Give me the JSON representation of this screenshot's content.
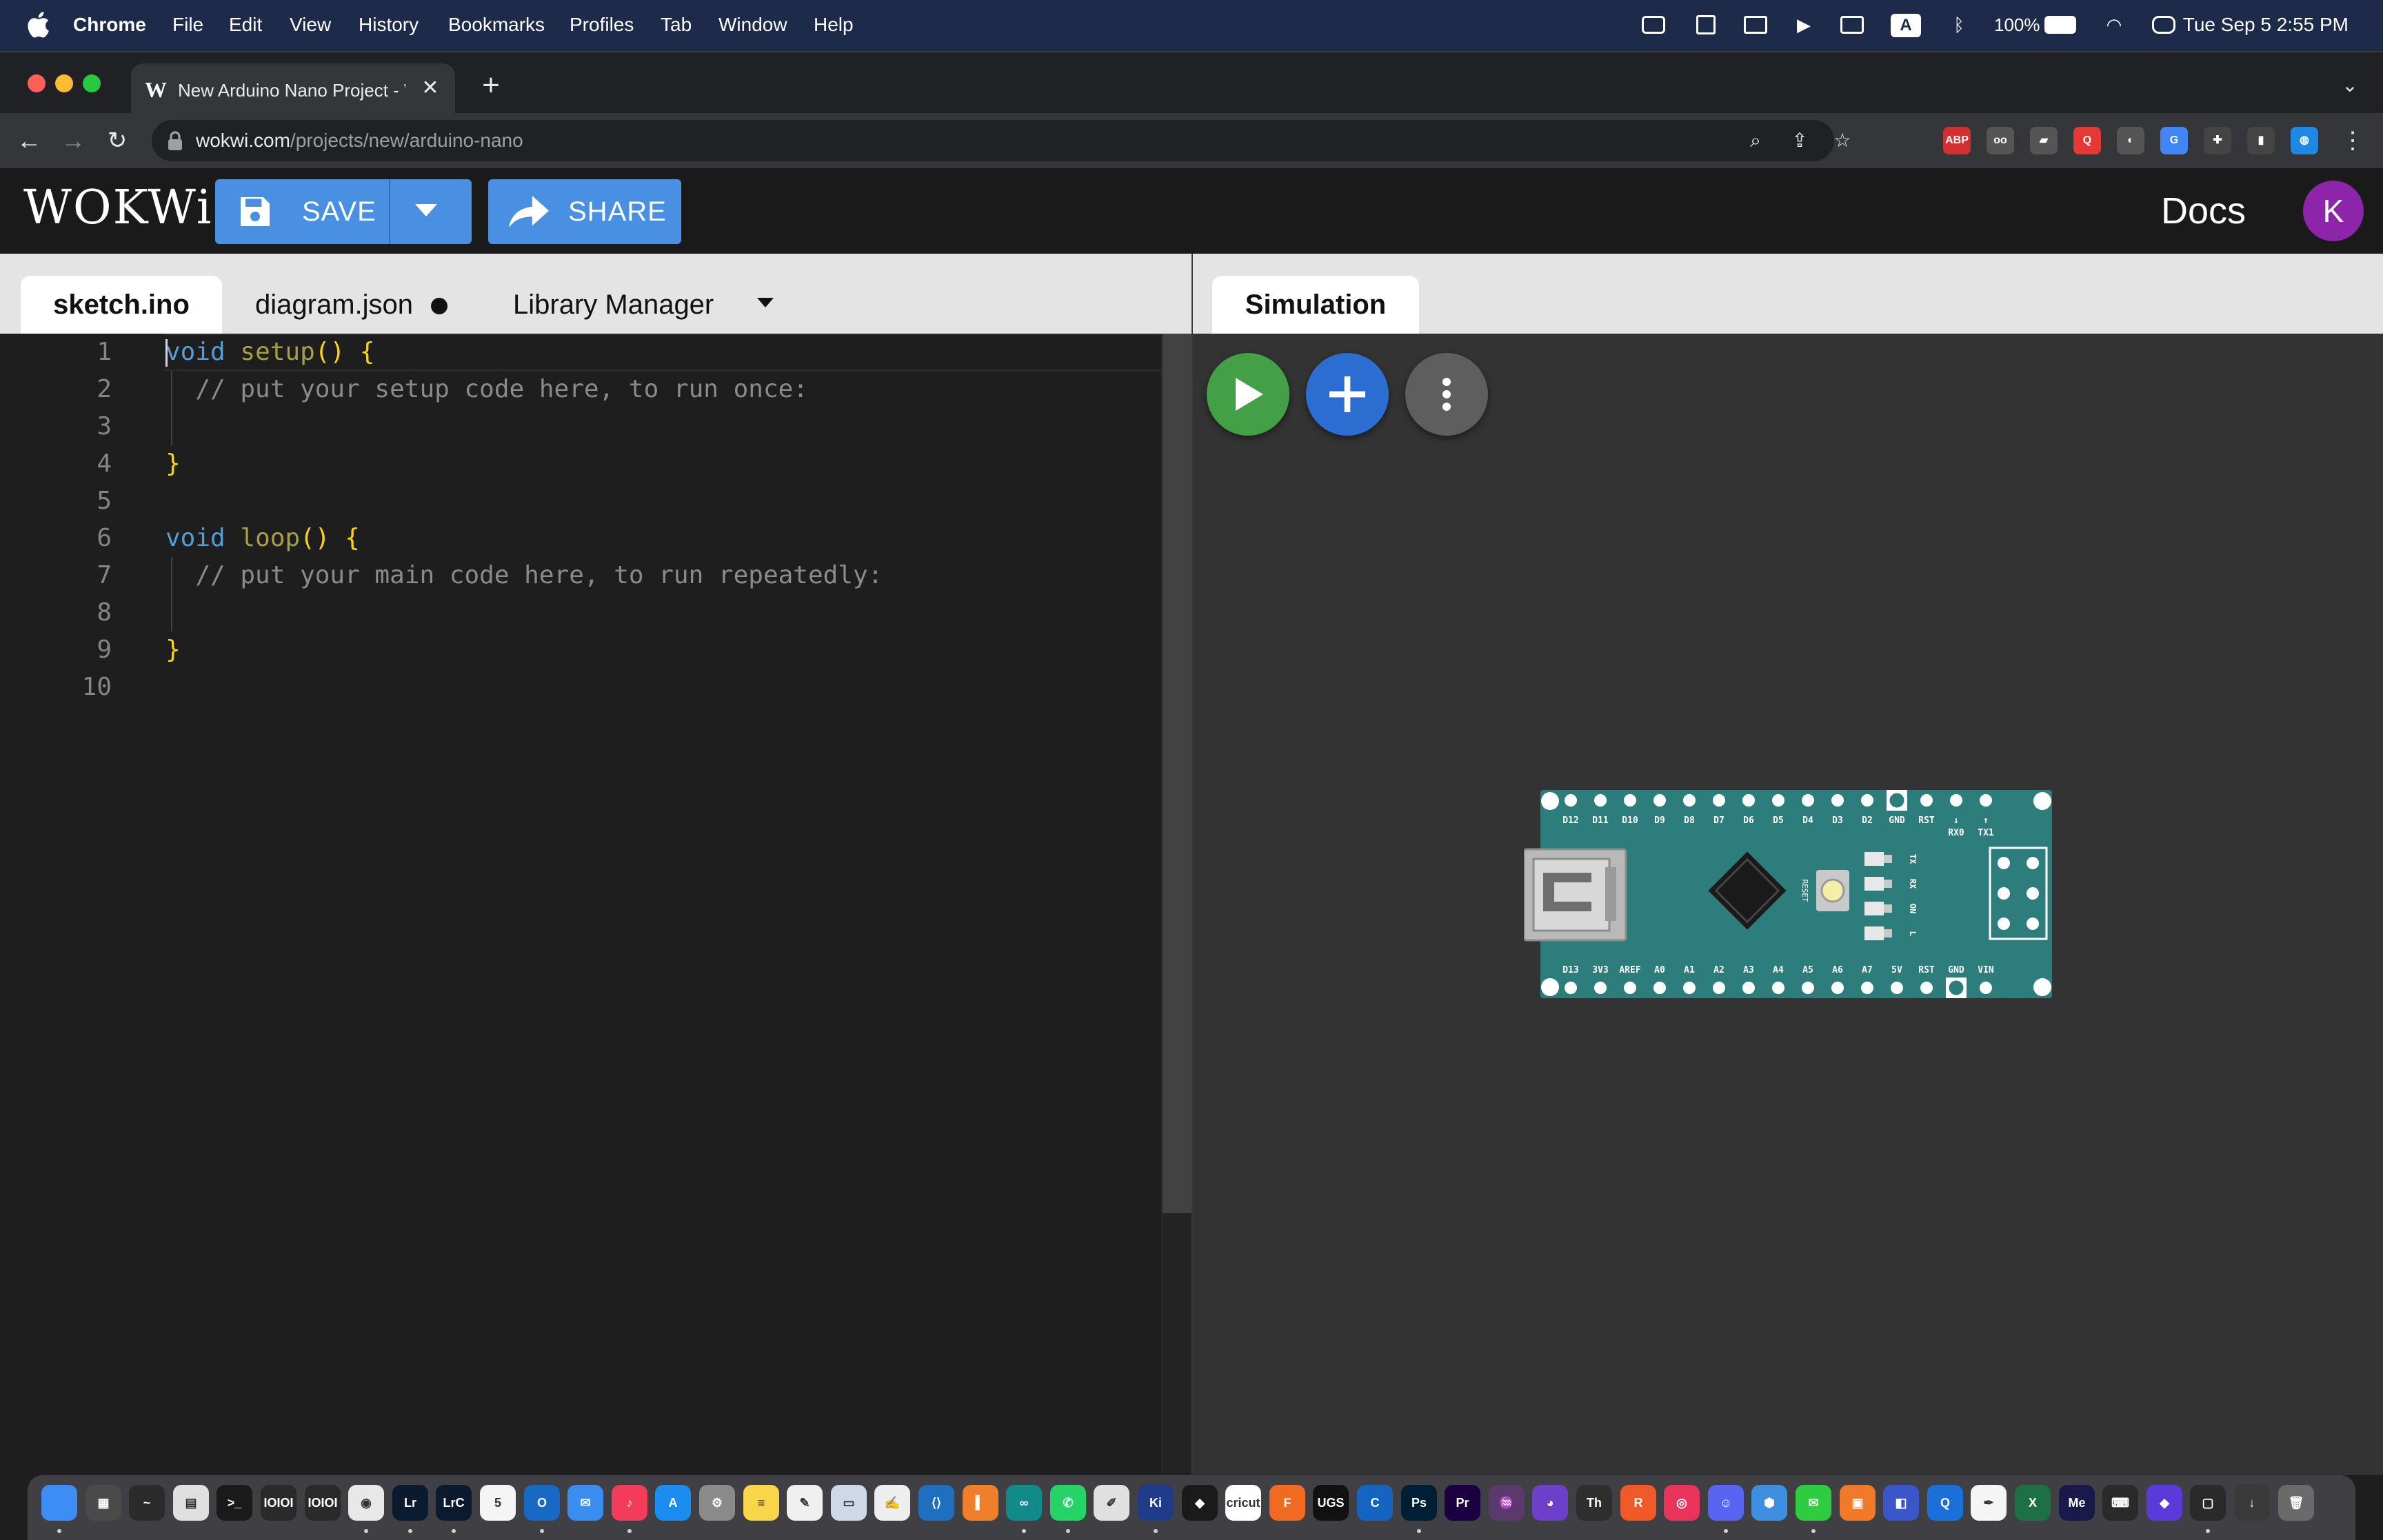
{
  "menubar": {
    "app_name": "Chrome",
    "items": [
      "File",
      "Edit",
      "View",
      "History",
      "Bookmarks",
      "Profiles",
      "Tab",
      "Window",
      "Help"
    ],
    "battery": "100%",
    "input_source": "A",
    "clock": "Tue Sep 5  2:55 PM"
  },
  "browser": {
    "tab_title": "New Arduino Nano Project - Wokwi",
    "tab_favicon": "W",
    "url_host": "wokwi.com",
    "url_path": "/projects/new/arduino-nano",
    "extensions": [
      {
        "label": "ABP",
        "color": "#d32f2f"
      },
      {
        "label": "oo",
        "color": "#555555"
      },
      {
        "label": "▰",
        "color": "#555555"
      },
      {
        "label": "Q",
        "color": "#e53935"
      },
      {
        "label": "◐",
        "color": "#555555"
      },
      {
        "label": "G",
        "color": "#4285f4"
      },
      {
        "label": "✚",
        "color": "#444444"
      },
      {
        "label": "▮",
        "color": "#444444"
      },
      {
        "label": "◍",
        "color": "#1e88e5"
      }
    ]
  },
  "wokwi": {
    "logo": "WOKWi",
    "save_label": "SAVE",
    "share_label": "SHARE",
    "docs_label": "Docs",
    "avatar_initial": "K"
  },
  "editor": {
    "tabs": {
      "sketch": "sketch.ino",
      "diagram": "diagram.json",
      "library": "Library Manager"
    },
    "line_numbers": [
      "1",
      "2",
      "3",
      "4",
      "5",
      "6",
      "7",
      "8",
      "9",
      "10"
    ],
    "code": {
      "l1_kw": "void",
      "l1_fn": "setup",
      "l1_pn": "() {",
      "l2_cm": "  // put your setup code here, to run once:",
      "l4_pn": "}",
      "l6_kw": "void",
      "l6_fn": "loop",
      "l6_pn": "() {",
      "l7_cm": "  // put your main code here, to run repeatedly:",
      "l9_pn": "}"
    }
  },
  "simulation": {
    "tab_label": "Simulation",
    "board": {
      "top_pins": [
        "D12",
        "D11",
        "D10",
        "D9",
        "D8",
        "D7",
        "D6",
        "D5",
        "D4",
        "D3",
        "D2",
        "GND",
        "RST",
        "↓",
        "↑"
      ],
      "rx_tx": [
        "RX0",
        "TX1"
      ],
      "bottom_pins": [
        "D13",
        "3V3",
        "AREF",
        "A0",
        "A1",
        "A2",
        "A3",
        "A4",
        "A5",
        "A6",
        "A7",
        "5V",
        "RST",
        "GND",
        "VIN"
      ],
      "led_labels": [
        "TX",
        "RX",
        "ON",
        "L"
      ],
      "reset_label": "RESET",
      "pcb_color": "#2e7d7d"
    }
  },
  "dock": {
    "apps": [
      {
        "name": "finder",
        "label": "",
        "color": "#3d8df5"
      },
      {
        "name": "calculator",
        "label": "▦",
        "color": "#4a4a4a"
      },
      {
        "name": "activity-monitor",
        "label": "~",
        "color": "#2b2b2b"
      },
      {
        "name": "printer",
        "label": "▤",
        "color": "#e0e0e0"
      },
      {
        "name": "terminal",
        "label": ">_",
        "color": "#1a1a1a"
      },
      {
        "name": "console-1",
        "label": "IOIOI",
        "color": "#2a2a2a"
      },
      {
        "name": "console-2",
        "label": "IOIOI",
        "color": "#2a2a2a"
      },
      {
        "name": "chrome",
        "label": "◉",
        "color": "#e8e8e8"
      },
      {
        "name": "lightroom",
        "label": "Lr",
        "color": "#0b1a2e"
      },
      {
        "name": "lightroom-classic",
        "label": "LrC",
        "color": "#0b1a2e"
      },
      {
        "name": "calendar",
        "label": "5",
        "color": "#f5f5f5"
      },
      {
        "name": "outlook",
        "label": "O",
        "color": "#1769c4"
      },
      {
        "name": "mail",
        "label": "✉",
        "color": "#3b8df0"
      },
      {
        "name": "music",
        "label": "♪",
        "color": "#f23c5a"
      },
      {
        "name": "app-store",
        "label": "A",
        "color": "#1b8cf0"
      },
      {
        "name": "system-settings",
        "label": "⚙",
        "color": "#8a8a8a"
      },
      {
        "name": "notes",
        "label": "≡",
        "color": "#f9d54a"
      },
      {
        "name": "freeform",
        "label": "✎",
        "color": "#f0f0f0"
      },
      {
        "name": "preview",
        "label": "▭",
        "color": "#cfd8e8"
      },
      {
        "name": "script-editor",
        "label": "✍",
        "color": "#eeeeee"
      },
      {
        "name": "vscode",
        "label": "⟨⟩",
        "color": "#1e6fbf"
      },
      {
        "name": "books",
        "label": "▍",
        "color": "#f07e2a"
      },
      {
        "name": "arduino",
        "label": "∞",
        "color": "#118a8a"
      },
      {
        "name": "whatsapp",
        "label": "✆",
        "color": "#25d366"
      },
      {
        "name": "pencil-app",
        "label": "✐",
        "color": "#e0e0e0"
      },
      {
        "name": "kicad",
        "label": "Ki",
        "color": "#1f3b8a"
      },
      {
        "name": "inkscape",
        "label": "◆",
        "color": "#1a1a1a"
      },
      {
        "name": "cricut",
        "label": "cricut",
        "color": "#ffffff"
      },
      {
        "name": "fusion",
        "label": "F",
        "color": "#f06a22"
      },
      {
        "name": "ugs",
        "label": "UGS",
        "color": "#111111"
      },
      {
        "name": "cura",
        "label": "C",
        "color": "#1565c0"
      },
      {
        "name": "photoshop",
        "label": "Ps",
        "color": "#001e36"
      },
      {
        "name": "premiere",
        "label": "Pr",
        "color": "#1a0040"
      },
      {
        "name": "audio-app",
        "label": "♒",
        "color": "#5a3a6a"
      },
      {
        "name": "github",
        "label": "◕",
        "color": "#6e40c9"
      },
      {
        "name": "typeface",
        "label": "Th",
        "color": "#2e2e2e"
      },
      {
        "name": "ruby-mine",
        "label": "R",
        "color": "#f05a28"
      },
      {
        "name": "creative-cloud",
        "label": "◎",
        "color": "#e8345a"
      },
      {
        "name": "discord",
        "label": "☺",
        "color": "#5865f2"
      },
      {
        "name": "sketchup",
        "label": "⬢",
        "color": "#3f8fe0"
      },
      {
        "name": "messages",
        "label": "✉",
        "color": "#2ecc40"
      },
      {
        "name": "photo-booth",
        "label": "▣",
        "color": "#f07a2a"
      },
      {
        "name": "screen-share",
        "label": "◧",
        "color": "#3a56c8"
      },
      {
        "name": "quicktime",
        "label": "Q",
        "color": "#1b6fd8"
      },
      {
        "name": "textedit",
        "label": "✒",
        "color": "#f5f5f5"
      },
      {
        "name": "excel",
        "label": "X",
        "color": "#1d7044"
      },
      {
        "name": "media-encoder",
        "label": "Me",
        "color": "#1a1a4a"
      },
      {
        "name": "keyboard-viewer",
        "label": "⌨",
        "color": "#2a2a2a"
      },
      {
        "name": "shortcuts",
        "label": "◆",
        "color": "#5a3ad8"
      },
      {
        "name": "screenshot",
        "label": "▢",
        "color": "#2a2a2a"
      },
      {
        "name": "downloads",
        "label": "↓",
        "color": "#3a3a3a"
      },
      {
        "name": "trash",
        "label": "🗑",
        "color": "#6a6a6a"
      }
    ]
  }
}
